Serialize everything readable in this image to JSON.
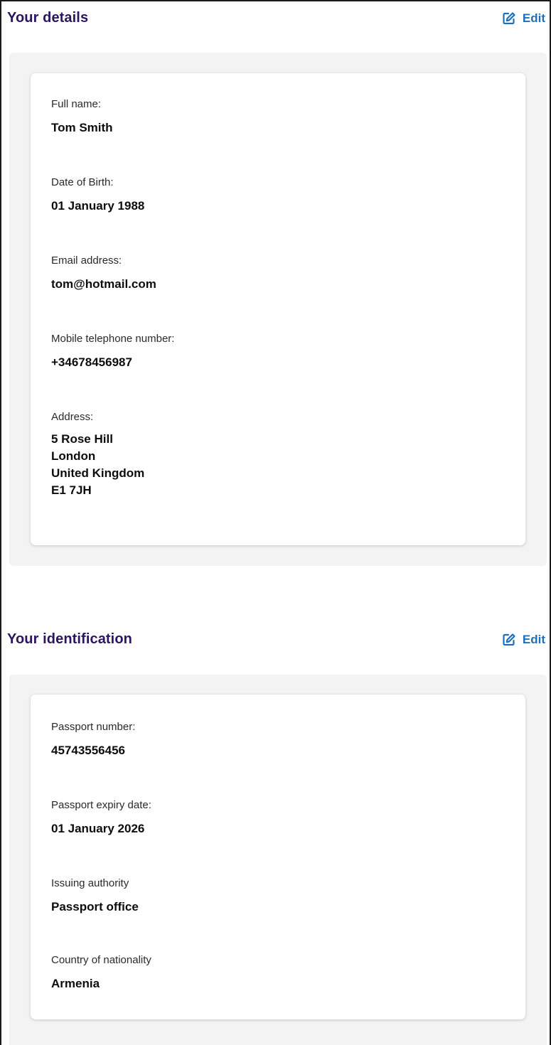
{
  "details": {
    "title": "Your details",
    "edit_label": "Edit",
    "fields": {
      "full_name": {
        "label": "Full name:",
        "value": "Tom Smith"
      },
      "dob": {
        "label": "Date of Birth:",
        "value": "01 January 1988"
      },
      "email": {
        "label": "Email address:",
        "value": "tom@hotmail.com"
      },
      "mobile": {
        "label": "Mobile telephone number:",
        "value": "+34678456987"
      },
      "address": {
        "label": "Address:",
        "lines": [
          "5 Rose Hill",
          "London",
          "United Kingdom",
          "E1 7JH"
        ]
      }
    }
  },
  "identification": {
    "title": "Your identification",
    "edit_label": "Edit",
    "fields": {
      "passport_number": {
        "label": "Passport number:",
        "value": "45743556456"
      },
      "passport_expiry": {
        "label": "Passport expiry date:",
        "value": "01 January 2026"
      },
      "issuing_authority": {
        "label": "Issuing authority",
        "value": "Passport office"
      },
      "nationality": {
        "label": "Country of nationality",
        "value": "Armenia"
      }
    }
  },
  "colors": {
    "title": "#2b1563",
    "link": "#1d70b8",
    "panel_bg": "#f3f3f3"
  },
  "icons": {
    "edit": "edit-pencil-square-icon"
  }
}
